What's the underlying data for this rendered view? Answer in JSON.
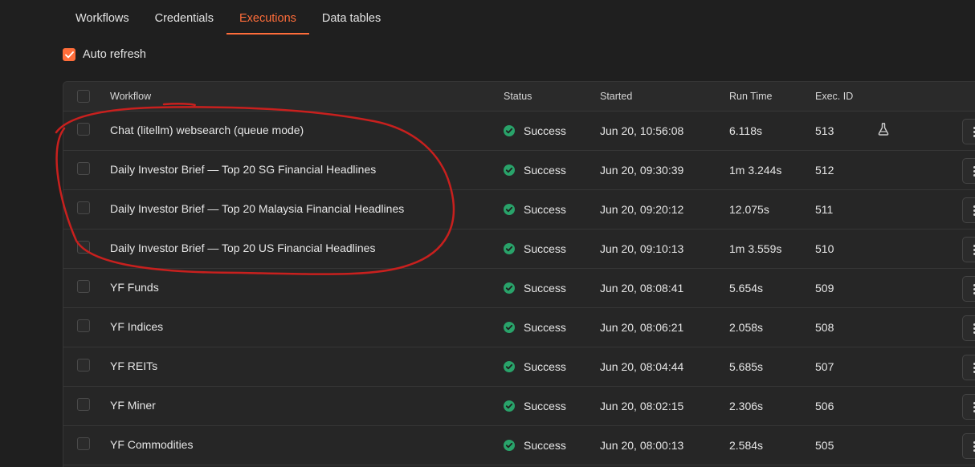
{
  "tabs": [
    {
      "label": "Workflows",
      "active": false
    },
    {
      "label": "Credentials",
      "active": false
    },
    {
      "label": "Executions",
      "active": true
    },
    {
      "label": "Data tables",
      "active": false
    }
  ],
  "auto_refresh": {
    "label": "Auto refresh",
    "checked": true
  },
  "columns": {
    "workflow": "Workflow",
    "status": "Status",
    "started": "Started",
    "run_time": "Run Time",
    "exec_id": "Exec. ID"
  },
  "executions": [
    {
      "workflow": "Chat (litellm) websearch (queue mode)",
      "status": "Success",
      "started": "Jun 20, 10:56:08",
      "run_time": "6.118s",
      "exec_id": "513",
      "has_flask": true
    },
    {
      "workflow": "Daily Investor Brief — Top 20 SG Financial Headlines",
      "status": "Success",
      "started": "Jun 20, 09:30:39",
      "run_time": "1m 3.244s",
      "exec_id": "512"
    },
    {
      "workflow": "Daily Investor Brief — Top 20 Malaysia Financial Headlines",
      "status": "Success",
      "started": "Jun 20, 09:20:12",
      "run_time": "12.075s",
      "exec_id": "511"
    },
    {
      "workflow": "Daily Investor Brief — Top 20 US Financial Headlines",
      "status": "Success",
      "started": "Jun 20, 09:10:13",
      "run_time": "1m 3.559s",
      "exec_id": "510"
    },
    {
      "workflow": "YF Funds",
      "status": "Success",
      "started": "Jun 20, 08:08:41",
      "run_time": "5.654s",
      "exec_id": "509"
    },
    {
      "workflow": "YF Indices",
      "status": "Success",
      "started": "Jun 20, 08:06:21",
      "run_time": "2.058s",
      "exec_id": "508"
    },
    {
      "workflow": "YF REITs",
      "status": "Success",
      "started": "Jun 20, 08:04:44",
      "run_time": "5.685s",
      "exec_id": "507"
    },
    {
      "workflow": "YF Miner",
      "status": "Success",
      "started": "Jun 20, 08:02:15",
      "run_time": "2.306s",
      "exec_id": "506"
    },
    {
      "workflow": "YF Commodities",
      "status": "Success",
      "started": "Jun 20, 08:00:13",
      "run_time": "2.584s",
      "exec_id": "505"
    }
  ],
  "colors": {
    "accent": "#ff6d3a",
    "success": "#29a36a",
    "annotation": "#c8201e"
  }
}
